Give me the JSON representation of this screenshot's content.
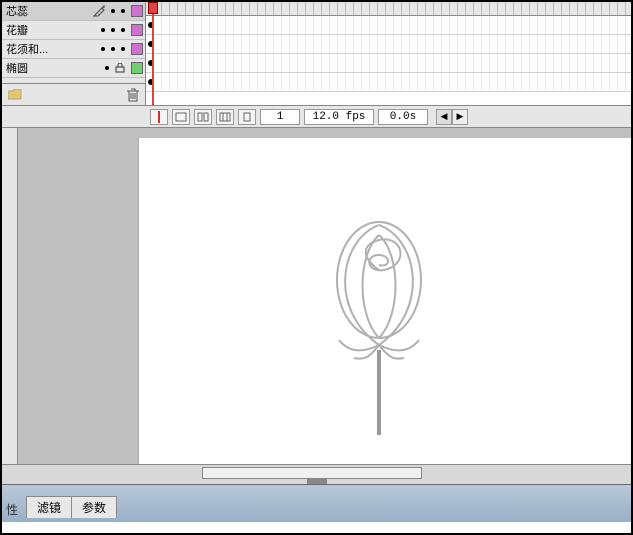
{
  "layers": [
    {
      "name": "芯蕊",
      "color": "#d070d0",
      "selected": true,
      "editing": true,
      "locked": false
    },
    {
      "name": "花瓣",
      "color": "#d070d0",
      "selected": false,
      "editing": false,
      "locked": false
    },
    {
      "name": "花须和...",
      "color": "#d070d0",
      "selected": false,
      "editing": false,
      "locked": false
    },
    {
      "name": "椭圆",
      "color": "#70d070",
      "selected": false,
      "editing": false,
      "locked": true
    }
  ],
  "timeline": {
    "current_frame": "1",
    "fps": "12.0 fps",
    "time": "0.0s"
  },
  "tabs": {
    "prefix": "性",
    "items": [
      "滤镜",
      "参数"
    ]
  },
  "colors": {
    "playhead": "#d44444"
  }
}
